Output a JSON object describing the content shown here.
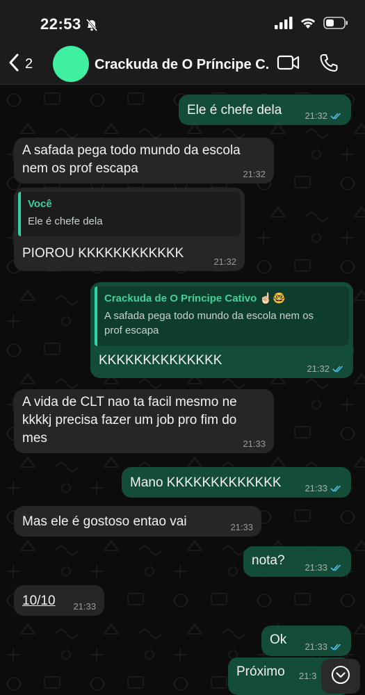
{
  "status_bar": {
    "time": "22:53"
  },
  "header": {
    "back_count": "2",
    "title": "Crackuda de O Príncipe C..."
  },
  "messages": [
    {
      "text": "Ele é chefe dela",
      "time": "21:32"
    },
    {
      "text": "A safada pega todo mundo da escola nem os prof escapa",
      "line1": "A safada pega todo mundo da escola",
      "line2": "nem os prof escapa",
      "time": "21:32"
    },
    {
      "quote_author": "Você",
      "quote_text": "Ele é chefe dela",
      "text": "PIOROU KKKKKKKKKKKK",
      "time": "21:32"
    },
    {
      "quote_author": "Crackuda de O Príncipe Cativo ☝🏻🤓",
      "quote_line1": "A safada pega todo mundo da escola nem os",
      "quote_line2": "prof escapa",
      "text": "KKKKKKKKKKKKKK",
      "time": "21:32"
    },
    {
      "line1": "A vida de CLT nao ta facil mesmo ne",
      "line2": "kkkkj precisa fazer um job pro fim do",
      "line3": "mes",
      "time": "21:33"
    },
    {
      "text": "Mano KKKKKKKKKKKKK",
      "time": "21:33"
    },
    {
      "text": "Mas ele é gostoso entao vai",
      "time": "21:33"
    },
    {
      "text": "nota?",
      "time": "21:33"
    },
    {
      "text": "10/10",
      "time": "21:33"
    },
    {
      "text": "Ok",
      "time": "21:33"
    },
    {
      "text": "Próximo",
      "time": "21:3"
    }
  ],
  "colors": {
    "incoming": "#262626",
    "outgoing": "#144d37",
    "accent": "#2fd5a8",
    "read_check": "#53bdeb"
  },
  "icons": [
    "bell-slash-icon",
    "signal-icon",
    "wifi-icon",
    "battery-icon",
    "chevron-left-icon",
    "video-icon",
    "phone-icon",
    "double-check-icon",
    "chevron-down-icon"
  ]
}
